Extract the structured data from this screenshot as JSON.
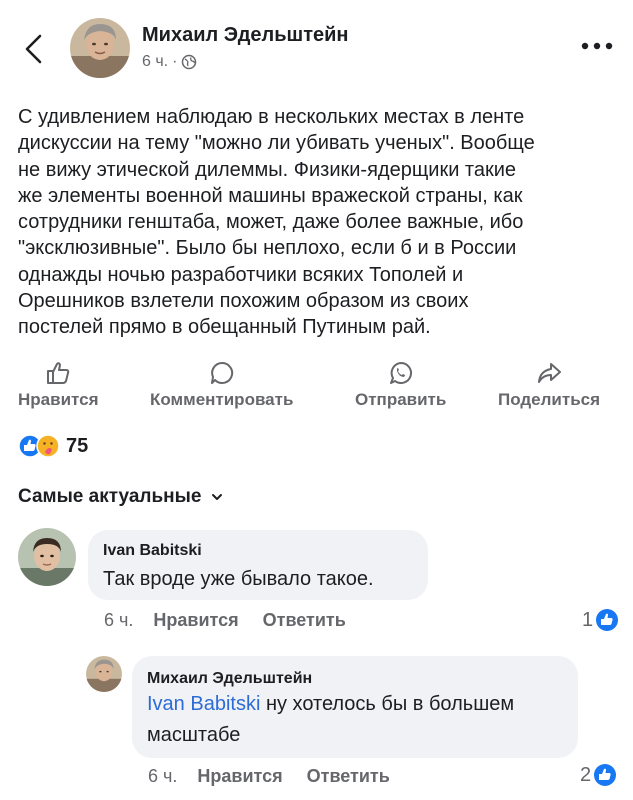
{
  "post": {
    "author": "Михаил Эдельштейн",
    "time": "6 ч.",
    "separator": "·",
    "text": "С удивлением наблюдаю в нескольких местах в ленте\nдискуссии на тему \"можно ли убивать ученых\". Вообще\nне вижу этической дилеммы. Физики-ядерщики такие\nже элементы военной машины вражеской страны, как\nсотрудники генштаба, может, даже более важные, ибо\n\"эксклюзивные\". Было бы неплохо, если б и в России\nоднажды ночью разработчики всяких Тополей и\nОрешников взлетели похожим образом из своих\nпостелей прямо в обещанный Путиным рай."
  },
  "actions": {
    "like": "Нравится",
    "comment": "Комментировать",
    "send": "Отправить",
    "share": "Поделиться"
  },
  "reactions": {
    "count": "75",
    "types": [
      "like-icon",
      "care-icon"
    ]
  },
  "sort": {
    "label": "Самые актуальные"
  },
  "comments": [
    {
      "author": "Ivan Babitski",
      "text": "Так вроде уже бывало такое.",
      "time": "6 ч.",
      "like_label": "Нравится",
      "reply_label": "Ответить",
      "likes": "1"
    },
    {
      "author": "Михаил Эдельштейн",
      "mention": "Ivan Babitski",
      "text": " ну хотелось бы в большем масштабе",
      "time": "6 ч.",
      "like_label": "Нравится",
      "reply_label": "Ответить",
      "likes": "2"
    }
  ],
  "colors": {
    "accent": "#1877f2",
    "mention": "#2d6bd6",
    "secondary_text": "#65676b",
    "bubble": "#f0f2f5"
  }
}
